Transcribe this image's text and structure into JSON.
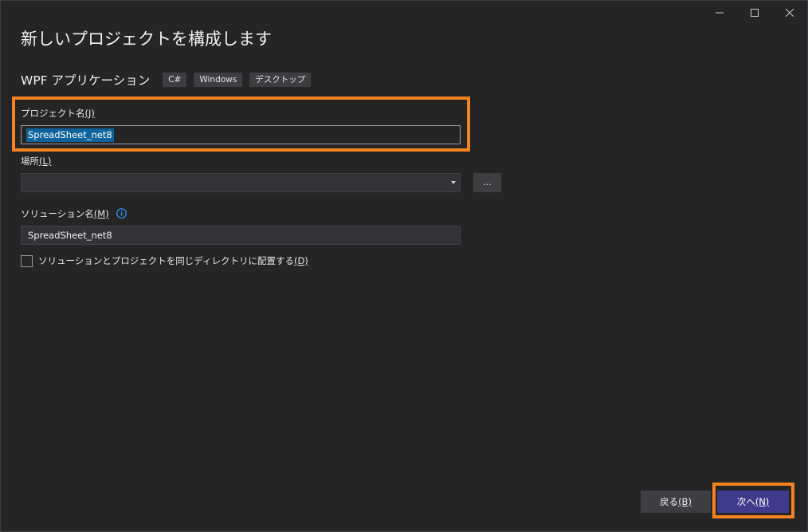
{
  "window": {
    "controls": [
      "minimize-icon",
      "maximize-icon",
      "close-icon"
    ]
  },
  "header": {
    "title": "新しいプロジェクトを構成します"
  },
  "template": {
    "name": "WPF アプリケーション",
    "tags": [
      "C#",
      "Windows",
      "デスクトップ"
    ]
  },
  "project_name": {
    "label": "プロジェクト名",
    "accel": "(J)",
    "value": "SpreadSheet_net8"
  },
  "location": {
    "label": "場所",
    "accel": "(L)",
    "value": "",
    "browse_label": "..."
  },
  "solution_name": {
    "label": "ソリューション名",
    "accel": "(M)",
    "value": "SpreadSheet_net8"
  },
  "same_dir": {
    "label": "ソリューションとプロジェクトを同じディレクトリに配置する",
    "accel": "(D)",
    "checked": false
  },
  "footer": {
    "back_label": "戻る",
    "back_accel": "(B)",
    "next_label": "次へ",
    "next_accel": "(N)"
  },
  "colors": {
    "background": "#252526",
    "highlight": "#f58220",
    "primary_button": "#3f3b8c",
    "selection": "#0e639c",
    "info": "#3794ff"
  }
}
